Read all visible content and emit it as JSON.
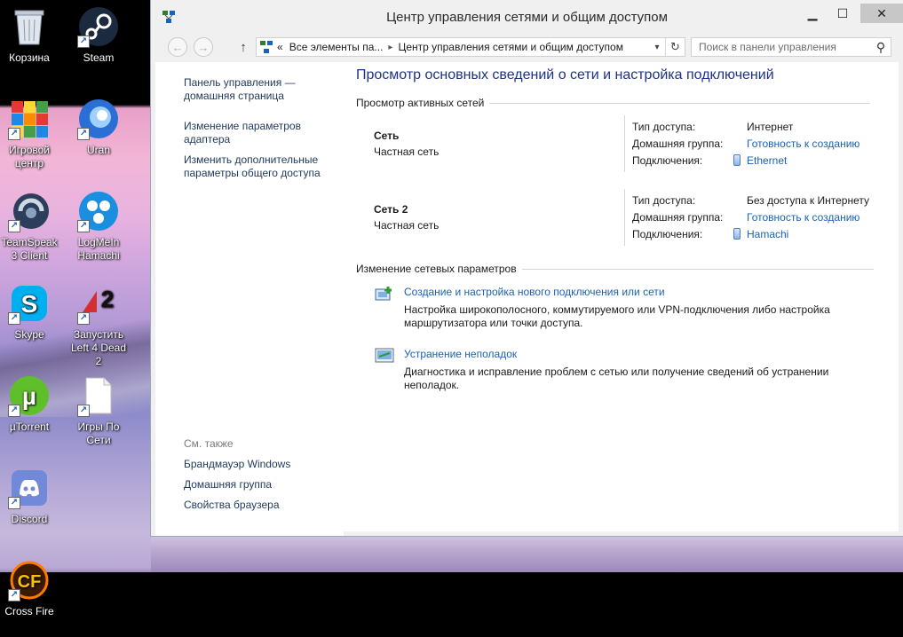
{
  "desktop": {
    "icons": [
      {
        "label": "Корзина"
      },
      {
        "label": "Steam"
      },
      {
        "label": "Игровой центр"
      },
      {
        "label": "Uran"
      },
      {
        "label": "TeamSpeak 3 Client"
      },
      {
        "label": "LogMeIn Hamachi"
      },
      {
        "label": "Skype"
      },
      {
        "label": "Запустить Left 4 Dead 2"
      },
      {
        "label": "µTorrent"
      },
      {
        "label": "Игры По Сети"
      },
      {
        "label": "Discord"
      },
      {
        "label": "Cross Fire"
      }
    ]
  },
  "window": {
    "title": "Центр управления сетями и общим доступом",
    "minimize": "▁",
    "maximize": "☐",
    "close": "✕"
  },
  "nav": {
    "back": "←",
    "forward": "→",
    "up": "↑",
    "address_prefix": "«",
    "address_part1": "Все элементы па...",
    "address_sep": "▸",
    "address_part2": "Центр управления сетями и общим доступом",
    "dropdown": "▾",
    "refresh": "↻",
    "search_placeholder": "Поиск в панели управления",
    "search_icon": "⚲"
  },
  "leftpane": {
    "home": "Панель управления — домашняя страница",
    "adapter": "Изменение параметров адаптера",
    "sharing": "Изменить дополнительные параметры общего доступа",
    "see_also": "См. также",
    "firewall": "Брандмауэр Windows",
    "homegroup": "Домашняя группа",
    "browser": "Свойства браузера"
  },
  "main": {
    "title": "Просмотр основных сведений о сети и настройка подключений",
    "active_networks_header": "Просмотр активных сетей",
    "labels": {
      "access_type": "Тип доступа:",
      "homegroup": "Домашняя группа:",
      "connections": "Подключения:"
    },
    "networks": [
      {
        "name": "Сеть",
        "type": "Частная сеть",
        "access": "Интернет",
        "homegroup": "Готовность к созданию",
        "connection": "Ethernet"
      },
      {
        "name": "Сеть  2",
        "type": "Частная сеть",
        "access": "Без доступа к Интернету",
        "homegroup": "Готовность к созданию",
        "connection": "Hamachi"
      }
    ],
    "change_header": "Изменение сетевых параметров",
    "tasks": [
      {
        "link": "Создание и настройка нового подключения или сети",
        "desc": "Настройка широкополосного, коммутируемого или VPN-подключения либо настройка маршрутизатора или точки доступа."
      },
      {
        "link": "Устранение неполадок",
        "desc": "Диагностика и исправление проблем с сетью или получение сведений об устранении неполадок."
      }
    ]
  },
  "colors": {
    "link": "#1a62b7",
    "title": "#1e3287",
    "nav_link": "#1e395b"
  }
}
